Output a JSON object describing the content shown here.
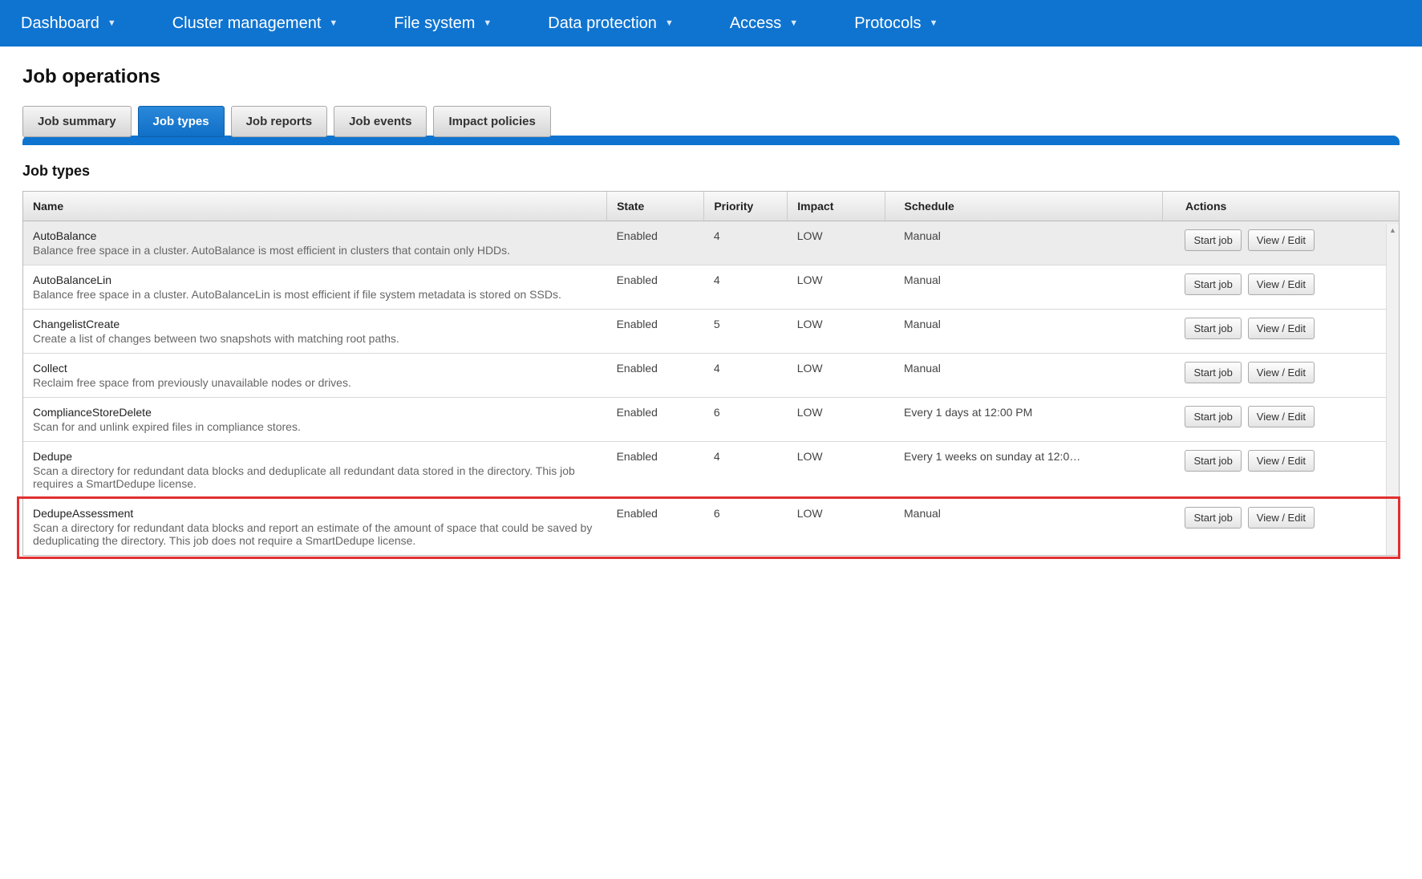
{
  "nav": [
    {
      "label": "Dashboard"
    },
    {
      "label": "Cluster management"
    },
    {
      "label": "File system"
    },
    {
      "label": "Data protection"
    },
    {
      "label": "Access"
    },
    {
      "label": "Protocols"
    }
  ],
  "page_title": "Job operations",
  "tabs": [
    {
      "label": "Job summary",
      "active": false
    },
    {
      "label": "Job types",
      "active": true
    },
    {
      "label": "Job reports",
      "active": false
    },
    {
      "label": "Job events",
      "active": false
    },
    {
      "label": "Impact policies",
      "active": false
    }
  ],
  "section_title": "Job types",
  "columns": {
    "name": "Name",
    "state": "State",
    "priority": "Priority",
    "impact": "Impact",
    "schedule": "Schedule",
    "actions": "Actions"
  },
  "buttons": {
    "start": "Start job",
    "view": "View / Edit"
  },
  "rows": [
    {
      "name": "AutoBalance",
      "desc": "Balance free space in a cluster. AutoBalance is most efficient in clusters that contain only HDDs.",
      "state": "Enabled",
      "priority": "4",
      "impact": "LOW",
      "schedule": "Manual"
    },
    {
      "name": "AutoBalanceLin",
      "desc": "Balance free space in a cluster. AutoBalanceLin is most efficient if file system metadata is stored on SSDs.",
      "state": "Enabled",
      "priority": "4",
      "impact": "LOW",
      "schedule": "Manual"
    },
    {
      "name": "ChangelistCreate",
      "desc": "Create a list of changes between two snapshots with matching root paths.",
      "state": "Enabled",
      "priority": "5",
      "impact": "LOW",
      "schedule": "Manual"
    },
    {
      "name": "Collect",
      "desc": "Reclaim free space from previously unavailable nodes or drives.",
      "state": "Enabled",
      "priority": "4",
      "impact": "LOW",
      "schedule": "Manual"
    },
    {
      "name": "ComplianceStoreDelete",
      "desc": "Scan for and unlink expired files in compliance stores.",
      "state": "Enabled",
      "priority": "6",
      "impact": "LOW",
      "schedule": "Every 1 days at 12:00 PM"
    },
    {
      "name": "Dedupe",
      "desc": "Scan a directory for redundant data blocks and deduplicate all redundant data stored in the directory. This job requires a SmartDedupe license.",
      "state": "Enabled",
      "priority": "4",
      "impact": "LOW",
      "schedule": "Every 1 weeks on sunday at 12:0…"
    },
    {
      "name": "DedupeAssessment",
      "desc": "Scan a directory for redundant data blocks and report an estimate of the amount of space that could be saved by deduplicating the directory. This job does not require a SmartDedupe license.",
      "state": "Enabled",
      "priority": "6",
      "impact": "LOW",
      "schedule": "Manual",
      "highlighted": true
    }
  ]
}
